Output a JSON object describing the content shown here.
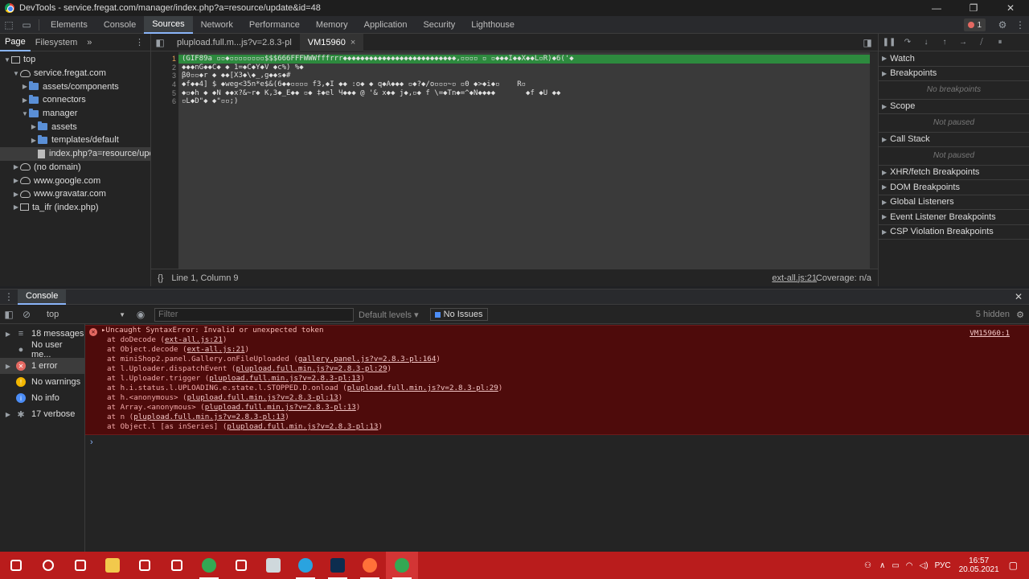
{
  "window": {
    "title": "DevTools - service.fregat.com/manager/index.php?a=resource/update&id=48",
    "minimize": "—",
    "maximize": "❐",
    "close": "✕"
  },
  "devtools_tabs": [
    "Elements",
    "Console",
    "Sources",
    "Network",
    "Performance",
    "Memory",
    "Application",
    "Security",
    "Lighthouse"
  ],
  "active_tab": "Sources",
  "error_count": "1",
  "navigator": {
    "tabs": [
      "Page",
      "Filesystem"
    ],
    "more": "»",
    "tree": [
      {
        "label": "top",
        "icon": "frame-icon",
        "depth": 0,
        "arrow": "▼"
      },
      {
        "label": "service.fregat.com",
        "icon": "cloud-icon",
        "depth": 1,
        "arrow": "▼"
      },
      {
        "label": "assets/components",
        "icon": "folder-icon",
        "depth": 2,
        "arrow": "▶"
      },
      {
        "label": "connectors",
        "icon": "folder-icon",
        "depth": 2,
        "arrow": "▶"
      },
      {
        "label": "manager",
        "icon": "folder-icon",
        "depth": 2,
        "arrow": "▼"
      },
      {
        "label": "assets",
        "icon": "folder-icon",
        "depth": 3,
        "arrow": "▶"
      },
      {
        "label": "templates/default",
        "icon": "folder-icon",
        "depth": 3,
        "arrow": "▶"
      },
      {
        "label": "index.php?a=resource/update",
        "icon": "file-icon",
        "depth": 3,
        "arrow": "",
        "selected": true
      },
      {
        "label": "(no domain)",
        "icon": "cloud-icon",
        "depth": 1,
        "arrow": "▶"
      },
      {
        "label": "www.google.com",
        "icon": "cloud-icon",
        "depth": 1,
        "arrow": "▶"
      },
      {
        "label": "www.gravatar.com",
        "icon": "cloud-icon",
        "depth": 1,
        "arrow": "▶"
      },
      {
        "label": "ta_ifr (index.php)",
        "icon": "frame-icon",
        "depth": 1,
        "arrow": "▶"
      }
    ]
  },
  "editor": {
    "tabs": [
      {
        "label": "plupload.full.m...js?v=2.8.3-pl",
        "active": false
      },
      {
        "label": "VM15960",
        "active": true,
        "close": "×"
      }
    ],
    "line_numbers": [
      "1",
      "2",
      "3",
      "4",
      "5",
      "6"
    ],
    "lines": [
      "(GIF89a ▫▫◆▫▫▫▫▫▫▫▫$$$666FFFWWWfffrrr◆◆◆◆◆◆◆◆◆◆◆◆◆◆◆◆◆◆◆◆◆◆◆◆◆◆,▫▫▫▫ ▫ ▫◆◆◆I◆◆X◆◆L▫R)◆6('◆",
      "◆◆◆nG◆◆C◆ ◆ 1=◆C◆Y◆V ◆c%) %◆",
      "β0▫▫◆r ◆ ◆◆[X3◆\\◆_,g◆◆s◆#",
      "◆f◆◆4] $ ◆weg<35n*e$&(6◆◆▫▫▫▫ f3,◆I ◆◆ :o◆ ◆ q◆A◆◆◆ ▫◆?◆/o▫▫▫~▫ ▫0 ◆>◆i◆▫    R▫",
      "◆▫◆h ◆ ◆N ◆◆x?&~r◆ K,3◆_E◆◆ ▫◆ ‡◆el Ч◆◆◆ @ '& x◆◆ j◆,▫◆ f \\=◆Tn◆=^◆N◆◆◆◆       ◆f ◆U ◆◆",
      "▫L◆D\"◆ ◆\"▫▫;)"
    ],
    "status_position": "Line 1, Column 9",
    "status_source": "ext-all.js:21",
    "status_coverage": "Coverage: n/a",
    "pretty_print": "{}"
  },
  "debugger": {
    "panes": [
      {
        "title": "Watch",
        "body": ""
      },
      {
        "title": "Breakpoints",
        "body": "No breakpoints"
      },
      {
        "title": "Scope",
        "body": "Not paused"
      },
      {
        "title": "Call Stack",
        "body": "Not paused"
      },
      {
        "title": "XHR/fetch Breakpoints",
        "body": ""
      },
      {
        "title": "DOM Breakpoints",
        "body": ""
      },
      {
        "title": "Global Listeners",
        "body": ""
      },
      {
        "title": "Event Listener Breakpoints",
        "body": ""
      },
      {
        "title": "CSP Violation Breakpoints",
        "body": ""
      }
    ]
  },
  "console": {
    "drawer_tab": "Console",
    "context": "top",
    "filter_placeholder": "Filter",
    "levels": "Default levels",
    "issues": "No Issues",
    "hidden": "5 hidden",
    "sidebar": [
      {
        "label": "18 messages",
        "icon": "list-icon",
        "arrow": "▶"
      },
      {
        "label": "No user me...",
        "icon": "user-icon",
        "arrow": ""
      },
      {
        "label": "1 error",
        "icon": "error-icon",
        "arrow": "▶"
      },
      {
        "label": "No warnings",
        "icon": "warning-icon",
        "arrow": ""
      },
      {
        "label": "No info",
        "icon": "info-icon",
        "arrow": ""
      },
      {
        "label": "17 verbose",
        "icon": "verbose-icon",
        "arrow": "▶"
      }
    ],
    "error": {
      "message": "▸Uncaught SyntaxError: Invalid or unexpected token",
      "source": "VM15960:1",
      "stack": [
        {
          "text": "at doDecode ",
          "link": "ext-all.js:21"
        },
        {
          "text": "at Object.decode ",
          "link": "ext-all.js:21"
        },
        {
          "text": "at miniShop2.panel.Gallery.onFileUploaded ",
          "link": "gallery.panel.js?v=2.8.3-pl:164"
        },
        {
          "text": "at l.Uploader.dispatchEvent ",
          "link": "plupload.full.min.js?v=2.8.3-pl:29"
        },
        {
          "text": "at l.Uploader.trigger ",
          "link": "plupload.full.min.js?v=2.8.3-pl:13"
        },
        {
          "text": "at h.i.status.l.UPLOADING.e.state.l.STOPPED.D.onload ",
          "link": "plupload.full.min.js?v=2.8.3-pl:29"
        },
        {
          "text": "at h.<anonymous> ",
          "link": "plupload.full.min.js?v=2.8.3-pl:13"
        },
        {
          "text": "at Array.<anonymous> ",
          "link": "plupload.full.min.js?v=2.8.3-pl:13"
        },
        {
          "text": "at n ",
          "link": "plupload.full.min.js?v=2.8.3-pl:13"
        },
        {
          "text": "at Object.l [as inSeries] ",
          "link": "plupload.full.min.js?v=2.8.3-pl:13"
        }
      ]
    },
    "prompt": "›"
  },
  "taskbar": {
    "apps": [
      "start-icon",
      "search-icon",
      "task-view-icon",
      "explorer-icon",
      "store-icon",
      "mail-icon",
      "chrome-icon",
      "chat-icon",
      "files-icon",
      "telegram-icon",
      "photoshop-icon",
      "firefox-icon",
      "chrome-devtools-icon"
    ],
    "lang": "РУС",
    "time": "16:57",
    "date": "20.05.2021"
  },
  "colors": {
    "accent": "#8ab4f8",
    "error_bg": "#4e0b0b",
    "taskbar": "#b91c1c",
    "highlight_line": "#2d8a3e"
  }
}
